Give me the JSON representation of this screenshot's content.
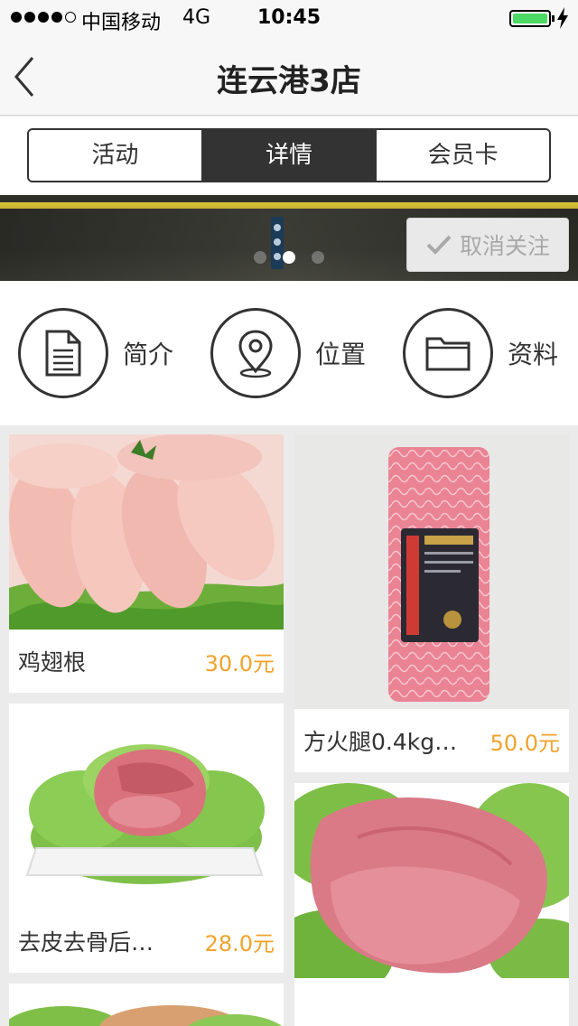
{
  "status": {
    "carrier": "中国移动",
    "network": "4G",
    "time": "10:45",
    "battery_percent": 100
  },
  "nav": {
    "title": "连云港3店"
  },
  "tabs": [
    {
      "label": "活动",
      "active": false
    },
    {
      "label": "详情",
      "active": true
    },
    {
      "label": "会员卡",
      "active": false
    }
  ],
  "banner": {
    "unfollow_label": "取消关注",
    "slide_count": 3,
    "active_slide": 2
  },
  "actions": [
    {
      "label": "简介",
      "icon": "document-icon"
    },
    {
      "label": "位置",
      "icon": "location-pin-icon"
    },
    {
      "label": "资料",
      "icon": "folder-icon"
    }
  ],
  "products": [
    {
      "name": "鸡翅根",
      "price": "30.0元"
    },
    {
      "name": "方火腿0.4kg…",
      "price": "50.0元"
    },
    {
      "name": "去皮去骨后…",
      "price": "28.0元"
    },
    {
      "name": "",
      "price": ""
    },
    {
      "name": "",
      "price": ""
    }
  ],
  "colors": {
    "accent": "#f0a32b",
    "tab_active": "#333333",
    "battery": "#4cd964"
  }
}
